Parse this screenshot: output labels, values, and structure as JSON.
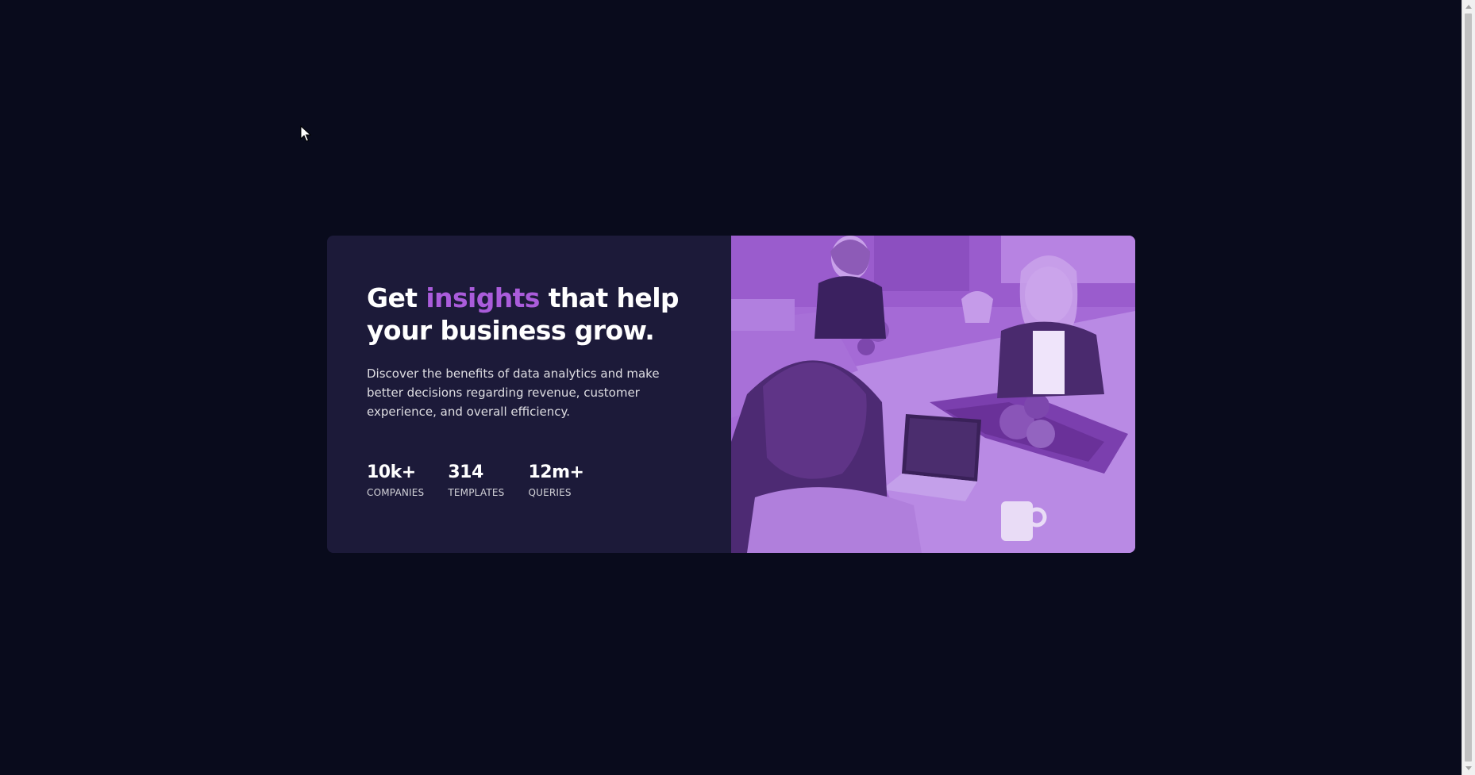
{
  "card": {
    "headline_start": "Get ",
    "headline_accent": "insights",
    "headline_end": " that help your business grow.",
    "description": "Discover the benefits of data analytics and make better decisions regarding revenue, customer experience, and overall efficiency.",
    "stats": [
      {
        "value": "10k+",
        "label": "COMPANIES"
      },
      {
        "value": "314",
        "label": "TEMPLATES"
      },
      {
        "value": "12m+",
        "label": "QUERIES"
      }
    ],
    "image_subject": "people-working-at-office-table"
  },
  "colors": {
    "page_background": "#090b1c",
    "card_background": "#1c1a39",
    "accent": "#aa5cdb",
    "image_overlay": "#a668d8"
  },
  "icons": {
    "cursor": "mouse-pointer-icon"
  }
}
